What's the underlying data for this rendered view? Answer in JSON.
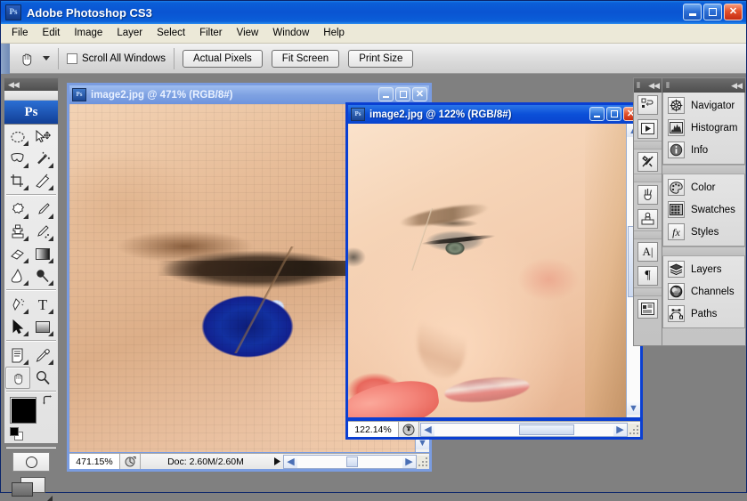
{
  "app": {
    "title": "Adobe Photoshop CS3",
    "logo_text": "Ps",
    "window_buttons": [
      {
        "name": "minimize",
        "glyph": "_"
      },
      {
        "name": "maximize",
        "glyph": "□"
      },
      {
        "name": "close",
        "glyph": "✕"
      }
    ]
  },
  "menubar": {
    "items": [
      "File",
      "Edit",
      "Image",
      "Layer",
      "Select",
      "Filter",
      "View",
      "Window",
      "Help"
    ]
  },
  "options_bar": {
    "active_tool_icon": "hand-tool-icon",
    "preset_dropdown_icon": "chevron-down-icon",
    "checkbox": {
      "label": "Scroll All Windows",
      "checked": false
    },
    "buttons": [
      "Actual Pixels",
      "Fit Screen",
      "Print Size"
    ]
  },
  "toolbox": {
    "collapse_icon": "double-chevron-left-icon",
    "logo_text": "Ps",
    "tools": [
      {
        "name": "marquee-tool",
        "glyph": "◯",
        "has_flyout": true
      },
      {
        "name": "move-tool",
        "glyph": "✥",
        "has_flyout": false
      },
      {
        "name": "lasso-tool",
        "glyph": "⌇",
        "has_flyout": true
      },
      {
        "name": "magic-wand-tool",
        "glyph": "✳",
        "has_flyout": true
      },
      {
        "name": "crop-tool",
        "glyph": "⊹",
        "has_flyout": true
      },
      {
        "name": "slice-tool",
        "glyph": "✂",
        "has_flyout": true
      },
      {
        "name": "healing-brush-tool",
        "glyph": "✺",
        "has_flyout": true
      },
      {
        "name": "brush-tool",
        "glyph": "✎",
        "has_flyout": true
      },
      {
        "name": "clone-stamp-tool",
        "glyph": "⎈",
        "has_flyout": true
      },
      {
        "name": "history-brush-tool",
        "glyph": "✒",
        "has_flyout": true
      },
      {
        "name": "eraser-tool",
        "glyph": "▱",
        "has_flyout": true
      },
      {
        "name": "gradient-tool",
        "glyph": "▤",
        "has_flyout": true
      },
      {
        "name": "blur-tool",
        "glyph": "💧",
        "has_flyout": true
      },
      {
        "name": "dodge-tool",
        "glyph": "●",
        "has_flyout": true
      },
      {
        "name": "pen-tool",
        "glyph": "✍",
        "has_flyout": true
      },
      {
        "name": "type-tool",
        "glyph": "T",
        "has_flyout": true
      },
      {
        "name": "path-selection-tool",
        "glyph": "➤",
        "has_flyout": true
      },
      {
        "name": "rectangle-shape-tool",
        "glyph": "▢",
        "has_flyout": true
      },
      {
        "name": "notes-tool",
        "glyph": "▤",
        "has_flyout": true
      },
      {
        "name": "eyedropper-tool",
        "glyph": "⚲",
        "has_flyout": true
      },
      {
        "name": "hand-tool",
        "glyph": "✋",
        "has_flyout": false,
        "selected": true
      },
      {
        "name": "zoom-tool",
        "glyph": "🔍",
        "has_flyout": false
      }
    ],
    "foreground_color": "#000000",
    "background_color": "#ffffff",
    "swap_icon": "swap-colors-icon",
    "default_colors_icon": "default-colors-icon",
    "quick_mask_icon": "quick-mask-icon",
    "screen_mode_icon": "screen-mode-icon"
  },
  "documents": [
    {
      "name": "doc-window-eye",
      "title": "image2.jpg @ 471% (RGB/8#)",
      "active": false,
      "zoom": "471.15%",
      "doc_info": "Doc: 2.60M/2.60M",
      "icon": "Ps",
      "buttons": [
        {
          "name": "minimize",
          "glyph": "_"
        },
        {
          "name": "maximize",
          "glyph": "□"
        },
        {
          "name": "close",
          "glyph": "✕"
        }
      ]
    },
    {
      "name": "doc-window-face",
      "title": "image2.jpg @ 122% (RGB/8#)",
      "active": true,
      "zoom": "122.14%",
      "doc_info": "",
      "icon": "Ps",
      "buttons": [
        {
          "name": "minimize",
          "glyph": "_"
        },
        {
          "name": "maximize",
          "glyph": "□"
        },
        {
          "name": "close",
          "glyph": "✕"
        }
      ]
    }
  ],
  "dock": {
    "collapse_icon": "double-chevron-left-icon",
    "icon_column": [
      {
        "name": "bridge-icon",
        "glyph": "⇄"
      },
      {
        "name": "animation-icon",
        "glyph": "▶"
      },
      {
        "name": "tool-presets-icon",
        "glyph": "⚒"
      },
      {
        "name": "brushes-icon",
        "glyph": "🖌"
      },
      {
        "name": "clone-source-icon",
        "glyph": "⚙"
      },
      {
        "name": "character-icon",
        "glyph": "A"
      },
      {
        "name": "paragraph-icon",
        "glyph": "¶"
      },
      {
        "name": "layer-comps-icon",
        "glyph": "▤"
      }
    ],
    "groups": [
      {
        "name": "navigator-group",
        "panels": [
          {
            "name": "navigator-panel",
            "label": "Navigator",
            "icon": "compass-icon"
          },
          {
            "name": "histogram-panel",
            "label": "Histogram",
            "icon": "histogram-icon"
          },
          {
            "name": "info-panel",
            "label": "Info",
            "icon": "info-icon"
          }
        ]
      },
      {
        "name": "color-group",
        "panels": [
          {
            "name": "color-panel",
            "label": "Color",
            "icon": "palette-icon"
          },
          {
            "name": "swatches-panel",
            "label": "Swatches",
            "icon": "swatches-grid-icon"
          },
          {
            "name": "styles-panel",
            "label": "Styles",
            "icon": "fx-icon"
          }
        ]
      },
      {
        "name": "layers-group",
        "panels": [
          {
            "name": "layers-panel",
            "label": "Layers",
            "icon": "layers-stack-icon"
          },
          {
            "name": "channels-panel",
            "label": "Channels",
            "icon": "channels-icon"
          },
          {
            "name": "paths-panel",
            "label": "Paths",
            "icon": "paths-node-icon"
          }
        ]
      }
    ]
  },
  "colors": {
    "titlebar_blue": "#0a54d2",
    "active_doc_border": "#0a3fd2",
    "inactive_doc_border": "#7a9ce0",
    "workspace_gray": "#808080",
    "menubar": "#ece9d8"
  }
}
